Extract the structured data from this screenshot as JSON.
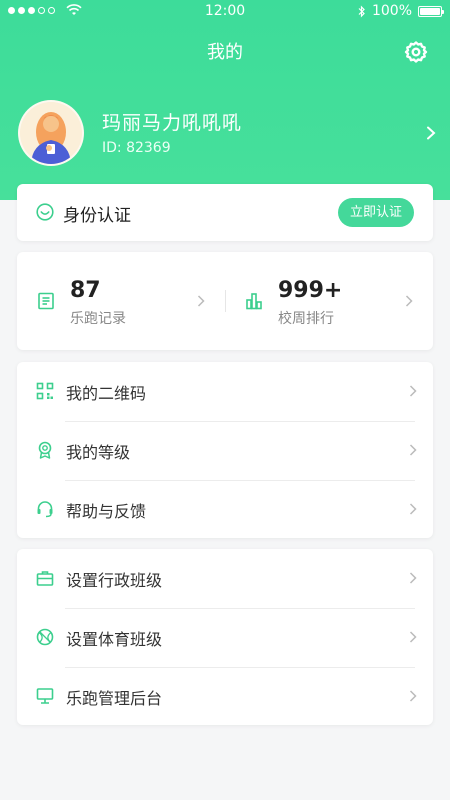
{
  "status_bar": {
    "time": "12:00",
    "battery": "100%"
  },
  "header": {
    "title": "我的"
  },
  "profile": {
    "name": "玛丽马力吼吼吼",
    "id": "ID: 82369"
  },
  "verify": {
    "label": "身份认证",
    "button": "立即认证"
  },
  "stats": [
    {
      "value": "87",
      "label": "乐跑记录",
      "icon": "document-icon"
    },
    {
      "value": "999+",
      "label": "校周排行",
      "icon": "bar-chart-icon"
    }
  ],
  "menu_group_1": [
    {
      "label": "我的二维码",
      "icon": "qr-code-icon"
    },
    {
      "label": "我的等级",
      "icon": "medal-icon"
    },
    {
      "label": "帮助与反馈",
      "icon": "headset-icon"
    }
  ],
  "menu_group_2": [
    {
      "label": "设置行政班级",
      "icon": "briefcase-icon"
    },
    {
      "label": "设置体育班级",
      "icon": "basketball-icon"
    },
    {
      "label": "乐跑管理后台",
      "icon": "monitor-icon"
    }
  ],
  "colors": {
    "accent": "#44d89a",
    "header_gradient_top": "#3ddc9a",
    "background": "#f5f6f7"
  }
}
